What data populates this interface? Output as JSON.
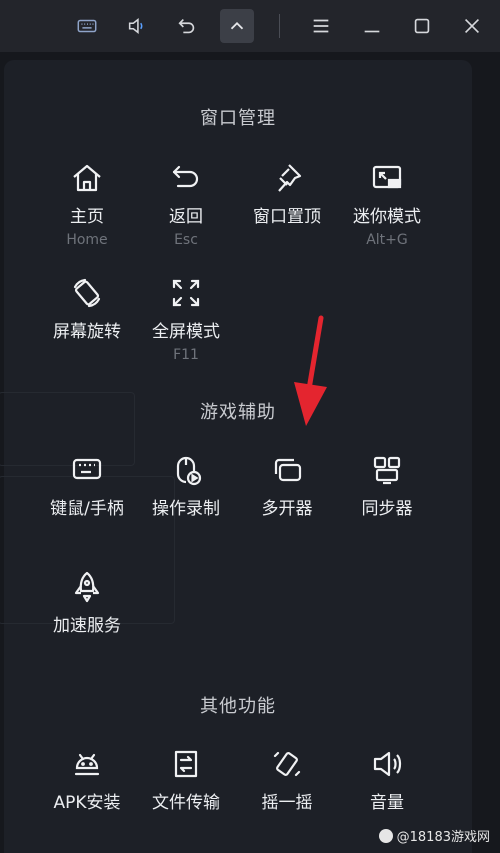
{
  "toolbar": {
    "buttons": [
      {
        "icon": "keyboard-icon"
      },
      {
        "icon": "volume-icon"
      },
      {
        "icon": "back-icon"
      },
      {
        "icon": "chevron-up-icon"
      },
      {
        "icon": "menu-icon"
      },
      {
        "icon": "minimize-icon"
      },
      {
        "icon": "maximize-icon"
      },
      {
        "icon": "close-icon"
      }
    ]
  },
  "sections": {
    "window": {
      "title": "窗口管理",
      "items": [
        {
          "label": "主页",
          "sub": "Home",
          "icon": "home-icon"
        },
        {
          "label": "返回",
          "sub": "Esc",
          "icon": "return-icon"
        },
        {
          "label": "窗口置顶",
          "sub": "",
          "icon": "pin-icon"
        },
        {
          "label": "迷你模式",
          "sub": "Alt+G",
          "icon": "mini-mode-icon"
        },
        {
          "label": "屏幕旋转",
          "sub": "",
          "icon": "rotate-icon"
        },
        {
          "label": "全屏模式",
          "sub": "F11",
          "icon": "fullscreen-icon"
        }
      ]
    },
    "game": {
      "title": "游戏辅助",
      "items": [
        {
          "label": "键鼠/手柄",
          "icon": "keyboard-mouse-icon"
        },
        {
          "label": "操作录制",
          "icon": "record-icon"
        },
        {
          "label": "多开器",
          "icon": "multi-instance-icon"
        },
        {
          "label": "同步器",
          "icon": "sync-icon"
        },
        {
          "label": "加速服务",
          "icon": "rocket-icon"
        }
      ]
    },
    "other": {
      "title": "其他功能",
      "items": [
        {
          "label": "APK安装",
          "icon": "android-icon"
        },
        {
          "label": "文件传输",
          "icon": "file-transfer-icon"
        },
        {
          "label": "摇一摇",
          "icon": "shake-icon"
        },
        {
          "label": "音量",
          "icon": "speaker-icon"
        }
      ]
    }
  },
  "watermark": "@18183游戏网",
  "colors": {
    "accent_arrow": "#e4252f",
    "panel": "#1d2027",
    "topbar": "#23252b"
  }
}
